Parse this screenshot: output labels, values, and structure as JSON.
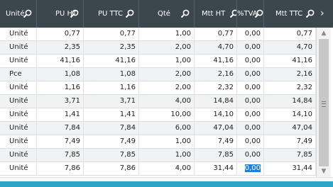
{
  "table": {
    "columns": [
      {
        "key": "unite",
        "label": "Unité"
      },
      {
        "key": "pu_ht",
        "label": "PU HT"
      },
      {
        "key": "pu_ttc",
        "label": "PU TTC"
      },
      {
        "key": "qte",
        "label": "Qté"
      },
      {
        "key": "mtt_ht",
        "label": "Mtt HT"
      },
      {
        "key": "tva",
        "label": "%TVA"
      },
      {
        "key": "mtt_ttc",
        "label": "Mtt TTC"
      }
    ],
    "rows": [
      {
        "unite": "Unité",
        "pu_ht": "0,77",
        "pu_ttc": "0,77",
        "qte": "1,00",
        "mtt_ht": "0,77",
        "tva": "0,00",
        "mtt_ttc": "0,77"
      },
      {
        "unite": "Unité",
        "pu_ht": "2,35",
        "pu_ttc": "2,35",
        "qte": "2,00",
        "mtt_ht": "4,70",
        "tva": "0,00",
        "mtt_ttc": "4,70"
      },
      {
        "unite": "Unité",
        "pu_ht": "41,16",
        "pu_ttc": "41,16",
        "qte": "1,00",
        "mtt_ht": "41,16",
        "tva": "0,00",
        "mtt_ttc": "41,16"
      },
      {
        "unite": "Pce",
        "pu_ht": "1,08",
        "pu_ttc": "1,08",
        "qte": "2,00",
        "mtt_ht": "2,16",
        "tva": "0,00",
        "mtt_ttc": "2,16"
      },
      {
        "unite": "Unité",
        "pu_ht": "1,16",
        "pu_ttc": "1,16",
        "qte": "2,00",
        "mtt_ht": "2,32",
        "tva": "0,00",
        "mtt_ttc": "2,32"
      },
      {
        "unite": "Unité",
        "pu_ht": "3,71",
        "pu_ttc": "3,71",
        "qte": "4,00",
        "mtt_ht": "14,84",
        "tva": "0,00",
        "mtt_ttc": "14,84"
      },
      {
        "unite": "Unité",
        "pu_ht": "1,41",
        "pu_ttc": "1,41",
        "qte": "10,00",
        "mtt_ht": "14,10",
        "tva": "0,00",
        "mtt_ttc": "14,10"
      },
      {
        "unite": "Unité",
        "pu_ht": "7,84",
        "pu_ttc": "7,84",
        "qte": "6,00",
        "mtt_ht": "47,04",
        "tva": "0,00",
        "mtt_ttc": "47,04"
      },
      {
        "unite": "Unité",
        "pu_ht": "7,49",
        "pu_ttc": "7,49",
        "qte": "1,00",
        "mtt_ht": "7,49",
        "tva": "0,00",
        "mtt_ttc": "7,49"
      },
      {
        "unite": "Unité",
        "pu_ht": "7,85",
        "pu_ttc": "7,85",
        "qte": "1,00",
        "mtt_ht": "7,85",
        "tva": "0,00",
        "mtt_ttc": "7,85"
      },
      {
        "unite": "Unité",
        "pu_ht": "7,86",
        "pu_ttc": "7,86",
        "qte": "4,00",
        "mtt_ht": "31,44",
        "tva": "0,00",
        "mtt_ttc": "31,44"
      }
    ],
    "selected_cell": {
      "row": 10,
      "column": "tva"
    }
  },
  "icons": {
    "column_search": "search-icon",
    "header_more": "chevron-right-icon",
    "scroll_up": "chevron-up-icon",
    "scroll_down": "chevron-down-icon",
    "scroll_grip": "grip-icon"
  },
  "colors": {
    "header_bg": "#3c464d",
    "selection": "#1f7fe0",
    "bottom_bar": "#2ca6c6"
  }
}
